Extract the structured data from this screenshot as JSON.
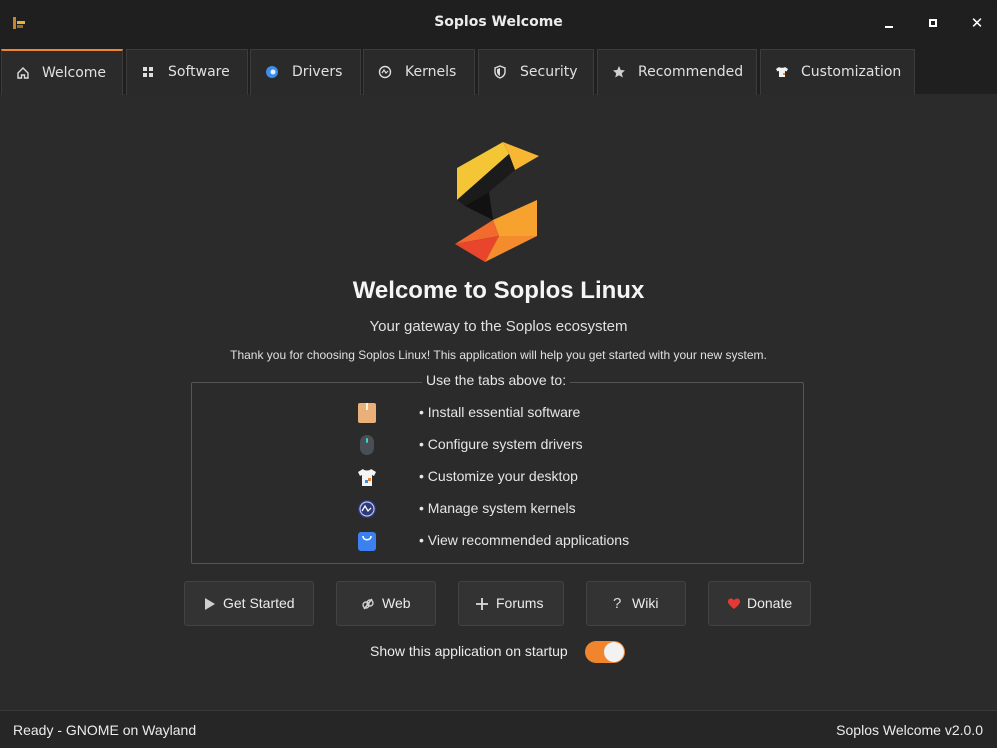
{
  "window": {
    "title": "Soplos Welcome"
  },
  "tabs": [
    {
      "label": "Welcome",
      "icon": "home-icon",
      "active": true
    },
    {
      "label": "Software",
      "icon": "grid-icon"
    },
    {
      "label": "Drivers",
      "icon": "driver-icon"
    },
    {
      "label": "Kernels",
      "icon": "kernel-icon"
    },
    {
      "label": "Security",
      "icon": "shield-icon"
    },
    {
      "label": "Recommended",
      "icon": "star-icon"
    },
    {
      "label": "Customization",
      "icon": "tshirt-icon"
    }
  ],
  "main": {
    "heading": "Welcome to Soplos Linux",
    "subtitle": "Your gateway to the Soplos ecosystem",
    "description": "Thank you for choosing Soplos Linux! This application will help you get started with your new system.",
    "features_title": "Use the tabs above to:",
    "features": [
      {
        "text": "• Install essential software",
        "icon": "package-icon"
      },
      {
        "text": "• Configure system drivers",
        "icon": "mouse-icon"
      },
      {
        "text": "• Customize your desktop",
        "icon": "tshirt-icon"
      },
      {
        "text": "• Manage system kernels",
        "icon": "kernel-icon"
      },
      {
        "text": "• View recommended applications",
        "icon": "shopping-bag-icon"
      }
    ]
  },
  "buttons": [
    {
      "label": "Get Started",
      "icon": "play-icon"
    },
    {
      "label": "Web",
      "icon": "link-icon"
    },
    {
      "label": "Forums",
      "icon": "plus-icon"
    },
    {
      "label": "Wiki",
      "icon": "question-icon"
    },
    {
      "label": "Donate",
      "icon": "heart-icon"
    }
  ],
  "startup_toggle": {
    "label": "Show this application on startup",
    "enabled": true
  },
  "status": {
    "left": "Ready - GNOME on Wayland",
    "right": "Soplos Welcome v2.0.0"
  },
  "colors": {
    "accent": "#f0852d",
    "background": "#2b2b2b",
    "titlebar": "#1f1f1f",
    "heart": "#e53935"
  }
}
